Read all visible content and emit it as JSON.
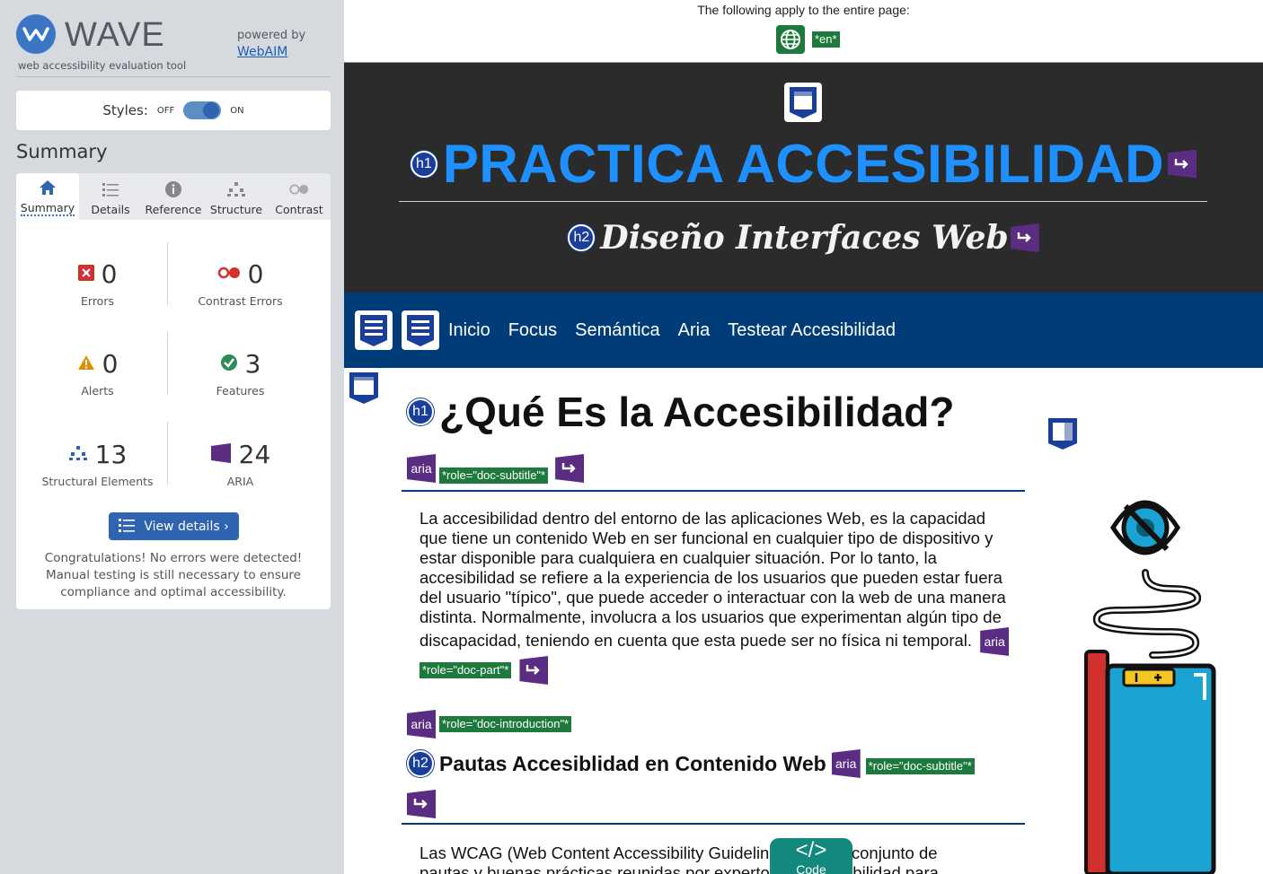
{
  "wave": {
    "title": "WAVE",
    "tagline": "web accessibility evaluation tool",
    "powered_by": "powered by",
    "webaim": "WebAIM",
    "styles_label": "Styles:",
    "styles_off": "OFF",
    "styles_on": "ON",
    "summary_heading": "Summary",
    "tabs": [
      {
        "label": "Summary",
        "icon": "home-icon"
      },
      {
        "label": "Details",
        "icon": "list-icon"
      },
      {
        "label": "Reference",
        "icon": "info-icon"
      },
      {
        "label": "Structure",
        "icon": "structure-icon"
      },
      {
        "label": "Contrast",
        "icon": "contrast-icon"
      }
    ],
    "stats": {
      "errors": {
        "value": "0",
        "label": "Errors"
      },
      "contrast_errors": {
        "value": "0",
        "label": "Contrast Errors"
      },
      "alerts": {
        "value": "0",
        "label": "Alerts"
      },
      "features": {
        "value": "3",
        "label": "Features"
      },
      "structural": {
        "value": "13",
        "label": "Structural Elements"
      },
      "aria": {
        "value": "24",
        "label": "ARIA"
      }
    },
    "view_details": "View details ›",
    "congrats": "Congratulations! No errors were detected! Manual testing is still necessary to ensure compliance and optimal accessibility."
  },
  "page": {
    "notice": "The following apply to the entire page:",
    "lang_tag": "*en*",
    "h1_badge": "h1",
    "h2_badge": "h2",
    "aria_badge": "aria",
    "site_title": "PRACTICA ACCESIBILIDAD",
    "site_subtitle": "Diseño Interfaces Web",
    "nav": [
      "Inicio",
      "Focus",
      "Semántica",
      "Aria",
      "Testear Accesibilidad"
    ],
    "main_heading": "¿Qué Es la Accesibilidad?",
    "role_doc_subtitle": "*role=\"doc-subtitle\"*",
    "intro_text": "La accesibilidad dentro del entorno de las aplicaciones Web, es la capacidad que tiene un contenido Web en ser funcional en cualquier tipo de dispositivo y estar disponible para cualquiera en cualquier situación. Por lo tanto, la accesibilidad se refiere a la experiencia de los usuarios que pueden estar fuera del usuario \"típico\", que puede acceder o interactuar con la web de una manera distinta. Normalmente, involucra a los usuarios que experimentan algún tipo de discapacidad, teniendo en cuenta que esta puede ser no física ni temporal.",
    "role_doc_part": "*role=\"doc-part\"*",
    "role_doc_introduction": "*role=\"doc-introduction\"*",
    "section_heading": "Pautas Accesiblidad en Contenido Web",
    "role_doc_subtitle_2": "*role=\"doc-subtitle\"*",
    "wcag_text": "Las WCAG (Web Content Accessibility Guidelines) son un conjunto de pautas y buenas prácticas reunidas por expertos en accesibilidad para",
    "code_glyph": "</>",
    "code_label": "Code"
  },
  "colors": {
    "wave_blue": "#2e64b0",
    "header_bg": "#2b2b2b",
    "title_blue": "#1e90ff",
    "nav_bg": "#003c78",
    "aria_purple": "#5a2d82",
    "tag_green": "#1e7a3c",
    "code_teal": "#13897d"
  }
}
